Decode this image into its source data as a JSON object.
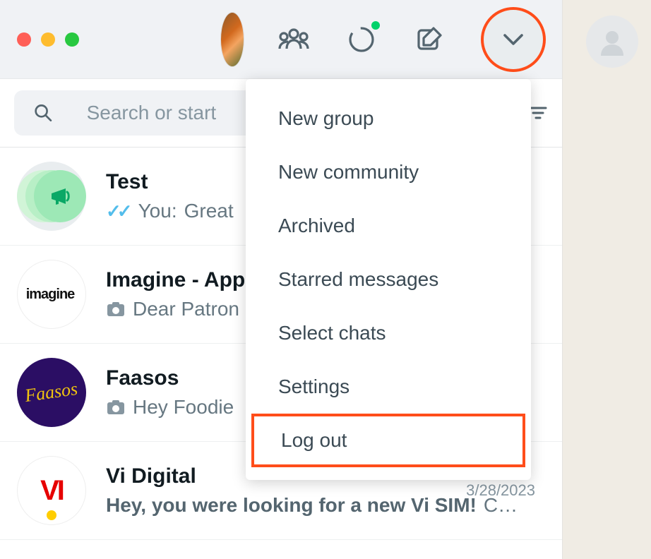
{
  "header": {
    "icons": {
      "communities": "communities",
      "status": "status",
      "new_chat": "new-chat",
      "menu": "menu"
    }
  },
  "search": {
    "placeholder": "Search or start"
  },
  "menu": {
    "items": [
      {
        "label": "New group"
      },
      {
        "label": "New community"
      },
      {
        "label": "Archived"
      },
      {
        "label": "Starred messages"
      },
      {
        "label": "Select chats"
      },
      {
        "label": "Settings"
      },
      {
        "label": "Log out",
        "highlight": true
      }
    ]
  },
  "chats": [
    {
      "title": "Test",
      "prefix": "You: ",
      "message": "Great",
      "read": true
    },
    {
      "title": "Imagine - App",
      "message": "Dear Patron",
      "camera": true
    },
    {
      "title": "Faasos",
      "message": "Hey Foodie",
      "camera": true
    },
    {
      "title": "Vi Digital",
      "message_bold": "Hey, you were looking for a new Vi SIM! ",
      "message_tail": "C…",
      "date": "3/28/2023"
    }
  ]
}
